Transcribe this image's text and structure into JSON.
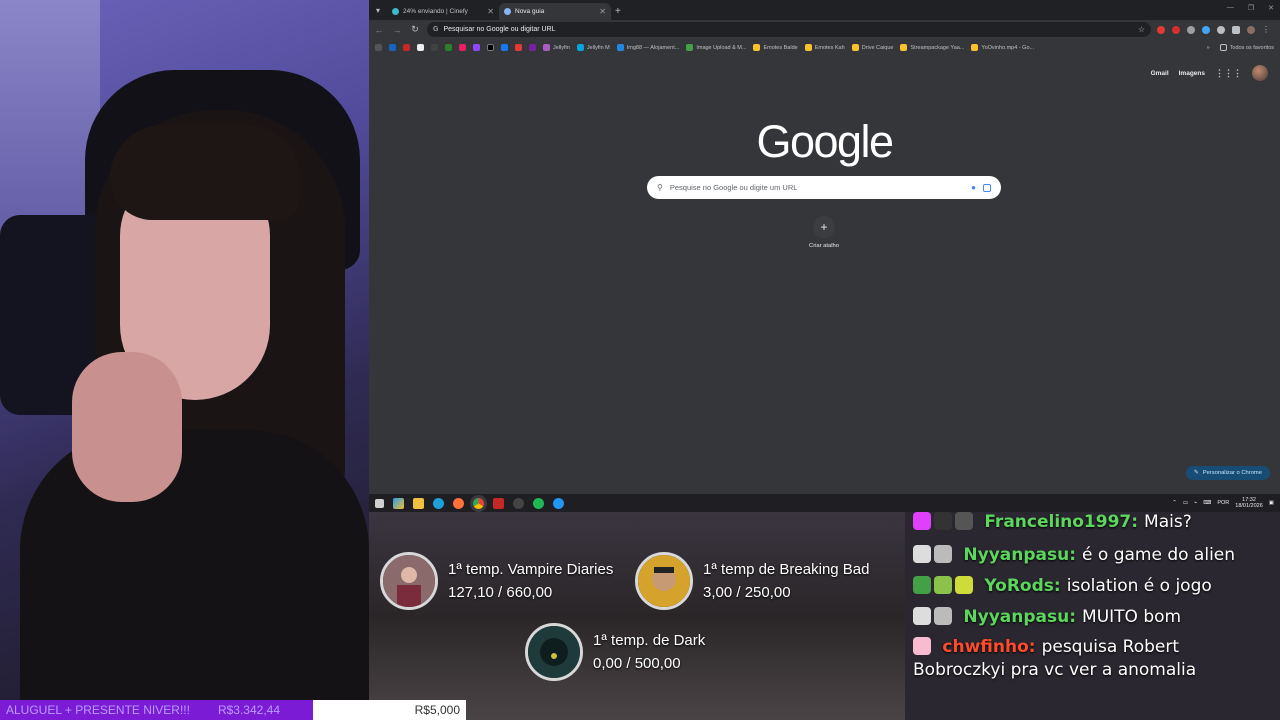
{
  "browser": {
    "tabs": [
      {
        "label": "24% enviando | Cinefy",
        "active": false
      },
      {
        "label": "Nova guia",
        "active": true
      }
    ],
    "omnibox_placeholder": "Pesquisar no Google ou digitar URL",
    "bookmarks": [
      {
        "label": "Jellyfin"
      },
      {
        "label": "Jellyfin M"
      },
      {
        "label": "Img88 — Alojament..."
      },
      {
        "label": "Image Upload & M..."
      },
      {
        "label": "Emotes Balde"
      },
      {
        "label": "Emotes Kah"
      },
      {
        "label": "Drive Caique"
      },
      {
        "label": "Streampackage Yaa..."
      },
      {
        "label": "YoOvinho.mp4 - Go..."
      }
    ],
    "bookmarks_all": "Todos os favoritos",
    "gmail": "Gmail",
    "images": "Imagens",
    "logo": "Google",
    "search_placeholder": "Pesquise no Google ou digite um URL",
    "shortcut_label": "Criar atalho",
    "customize_label": "Personalizar o Chrome"
  },
  "taskbar": {
    "lang": "POR",
    "time": "17:32",
    "date": "18/01/2026"
  },
  "goals": [
    {
      "title": "1ª temp. Vampire Diaries",
      "value": "127,10  /  660,00",
      "color": "#7a2b3c"
    },
    {
      "title": "1ª temp de Breaking Bad",
      "value": "3,00  /  250,00",
      "color": "#d5a22c"
    },
    {
      "title": "1ª temp. de Dark",
      "value": "0,00  /  500,00",
      "color": "#1f3a3a"
    }
  ],
  "chat": [
    {
      "user": "Francelino1997:",
      "text": "Mais?",
      "color": "#5cd65c"
    },
    {
      "user": "Nyyanpasu:",
      "text": "é o game do alien",
      "color": "#5cd65c"
    },
    {
      "user": "YoRods:",
      "text": "isolation é o jogo",
      "color": "#5cd65c"
    },
    {
      "user": "Nyyanpasu:",
      "text": "MUITO bom",
      "color": "#5cd65c"
    },
    {
      "user": "chwfinho:",
      "text": "pesquisa Robert Bobroczkyi pra vc ver a anomalia",
      "color": "#ff4b2b"
    }
  ],
  "goalbar": {
    "label": "ALUGUEL + PRESENTE NIVER!!!",
    "current": "R$3.342,44",
    "target": "R$5,000",
    "progress": 0.67
  }
}
